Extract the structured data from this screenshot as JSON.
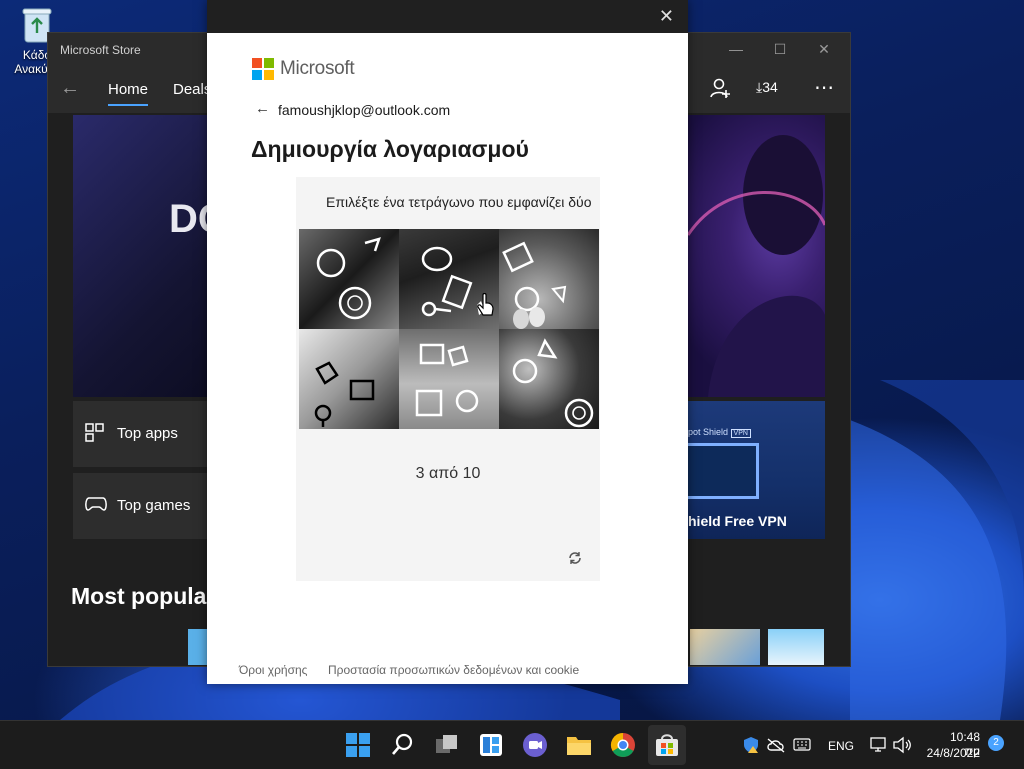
{
  "desktop": {
    "recycle_bin_line1": "Κάδο",
    "recycle_bin_line2": "Ανακύκλ"
  },
  "store": {
    "title": "Microsoft Store",
    "nav": {
      "home": "Home",
      "deals": "Deals",
      "downloads_count": "34"
    },
    "hero_letters": "DC",
    "tiles": {
      "top_apps": "Top apps",
      "top_games": "Top games"
    },
    "vpn": {
      "top_label": "pot Shield",
      "badge": "VPN",
      "name": "hield Free VPN"
    },
    "section_title": "Most popula"
  },
  "dialog": {
    "brand": "Microsoft",
    "email": "famoushjklop@outlook.com",
    "heading": "Δημιουργία λογαριασμού",
    "captcha": {
      "instruction": "Επιλέξτε ένα τετράγωνο που εμφανίζει δύο",
      "progress": "3 από 10"
    },
    "footer": {
      "terms": "Όροι χρήσης",
      "privacy": "Προστασία προσωπικών δεδομένων και cookie"
    }
  },
  "taskbar": {
    "language": "ENG",
    "time": "10:48 πμ",
    "date": "24/8/2022",
    "notifications": "2"
  },
  "colors": {
    "ms_red": "#f25022",
    "ms_green": "#7fba00",
    "ms_blue": "#00a4ef",
    "ms_yellow": "#ffb900",
    "accent": "#4aa3ff"
  }
}
